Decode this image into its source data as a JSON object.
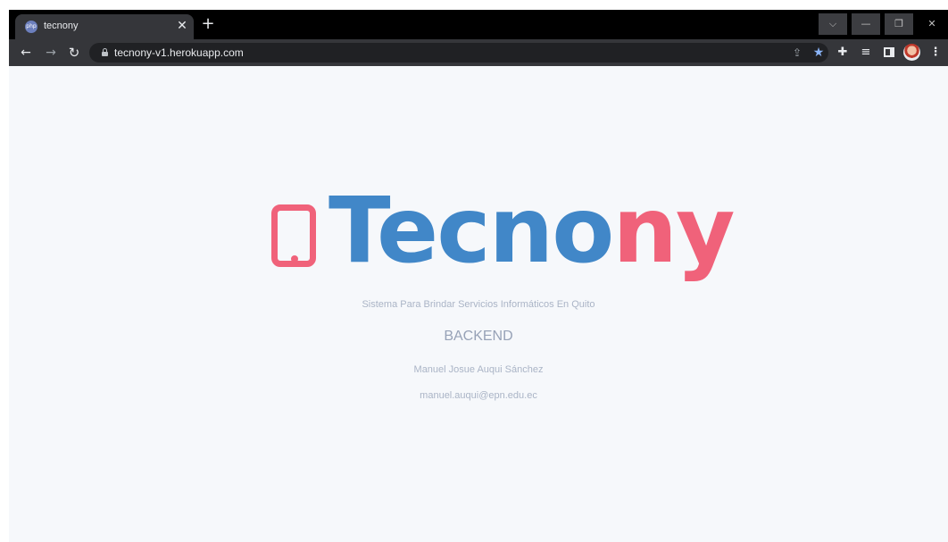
{
  "browser": {
    "tab": {
      "favicon_text": "php",
      "title": "tecnony",
      "close_icon": "close-icon"
    },
    "new_tab_icon": "plus-icon",
    "window_controls": {
      "search_tabs_icon": "chevron-down-icon",
      "minimize_icon": "minimize-icon",
      "maximize_icon": "restore-icon",
      "close_icon": "close-icon"
    },
    "toolbar": {
      "back_icon": "arrow-left-icon",
      "forward_icon": "arrow-right-icon",
      "reload_icon": "reload-icon",
      "url": "tecnony-v1.herokuapp.com",
      "share_icon": "share-icon",
      "bookmark_icon": "star-icon",
      "extensions_icon": "puzzle-icon",
      "reading_list_icon": "queue-icon",
      "side_panel_icon": "side-panel-icon",
      "profile_icon": "avatar",
      "menu_icon": "kebab-menu-icon"
    }
  },
  "page": {
    "logo": {
      "text_blue": "Tecno",
      "text_pink": "ny",
      "device_icon": "smartphone-icon",
      "colors": {
        "blue": "#4187c8",
        "pink": "#f0627a"
      }
    },
    "subtitle": "Sistema Para Brindar Servicios Informáticos En Quito",
    "section_title": "BACKEND",
    "author": "Manuel Josue Auqui Sánchez",
    "email": "manuel.auqui@epn.edu.ec"
  }
}
